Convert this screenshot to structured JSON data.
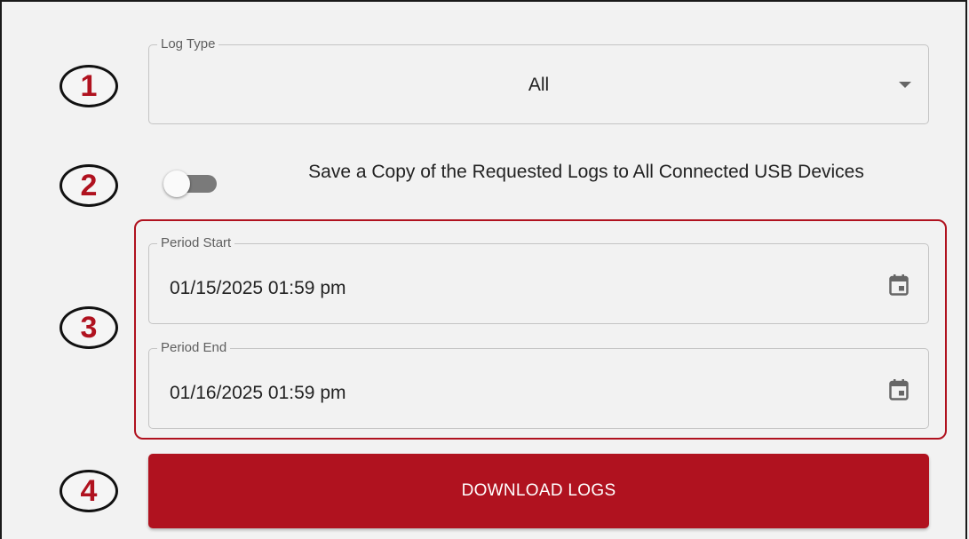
{
  "steps": [
    "1",
    "2",
    "3",
    "4"
  ],
  "log_type": {
    "label": "Log Type",
    "value": "All"
  },
  "usb_copy": {
    "label": "Save a Copy of the Requested Logs to All Connected USB Devices",
    "enabled": false
  },
  "period_start": {
    "label": "Period Start",
    "value": "01/15/2025 01:59 pm"
  },
  "period_end": {
    "label": "Period End",
    "value": "01/16/2025 01:59 pm"
  },
  "download": {
    "label": "DOWNLOAD LOGS"
  },
  "icons": {
    "select_caret": "caret-down-icon",
    "calendar": "calendar-icon"
  },
  "colors": {
    "accent": "#b0121f",
    "toggle_track": "#7a7a7a",
    "background": "#f2f2f2"
  }
}
